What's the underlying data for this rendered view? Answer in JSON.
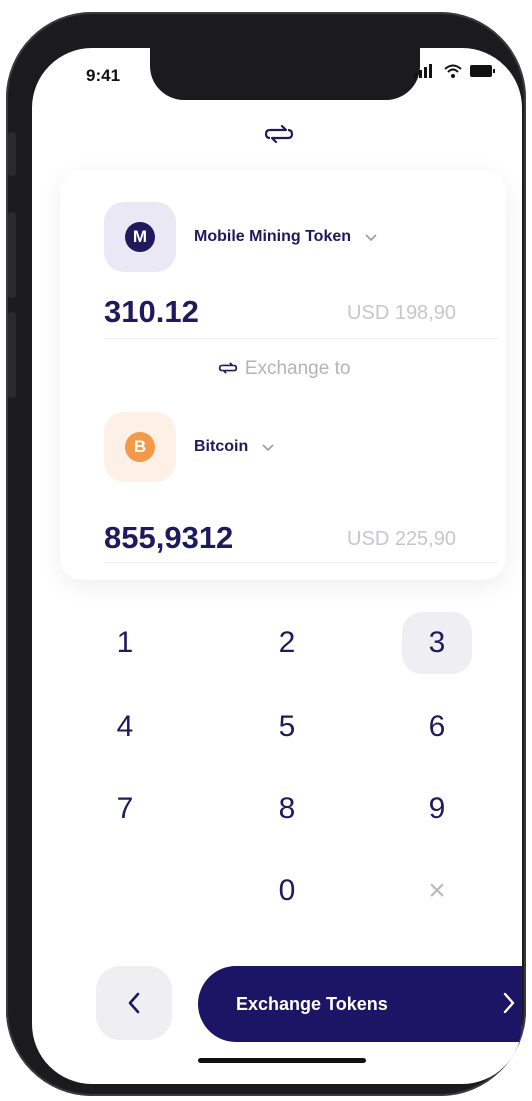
{
  "status_bar": {
    "time": "9:41"
  },
  "from_token": {
    "symbol": "M",
    "name": "Mobile Mining Token",
    "amount": "310.12",
    "usd": "USD 198,90",
    "color": "#1e1a5c"
  },
  "exchange_label": "Exchange to",
  "to_token": {
    "symbol": "B",
    "name": "Bitcoin",
    "amount": "855,9312",
    "usd": "USD 225,90",
    "color": "#f29a4a"
  },
  "keypad": {
    "keys": [
      "1",
      "2",
      "3",
      "4",
      "5",
      "6",
      "7",
      "8",
      "9",
      "0",
      "×"
    ],
    "active_key": "3"
  },
  "actions": {
    "exchange_button": "Exchange Tokens"
  },
  "colors": {
    "primary": "#1c1464",
    "text": "#1e1a5c",
    "muted": "#c6c6cc"
  },
  "icons": [
    "swap-icon",
    "chevron-down-icon",
    "back-chevron-icon",
    "forward-chevron-icon",
    "signal-icon",
    "wifi-icon",
    "battery-icon"
  ]
}
